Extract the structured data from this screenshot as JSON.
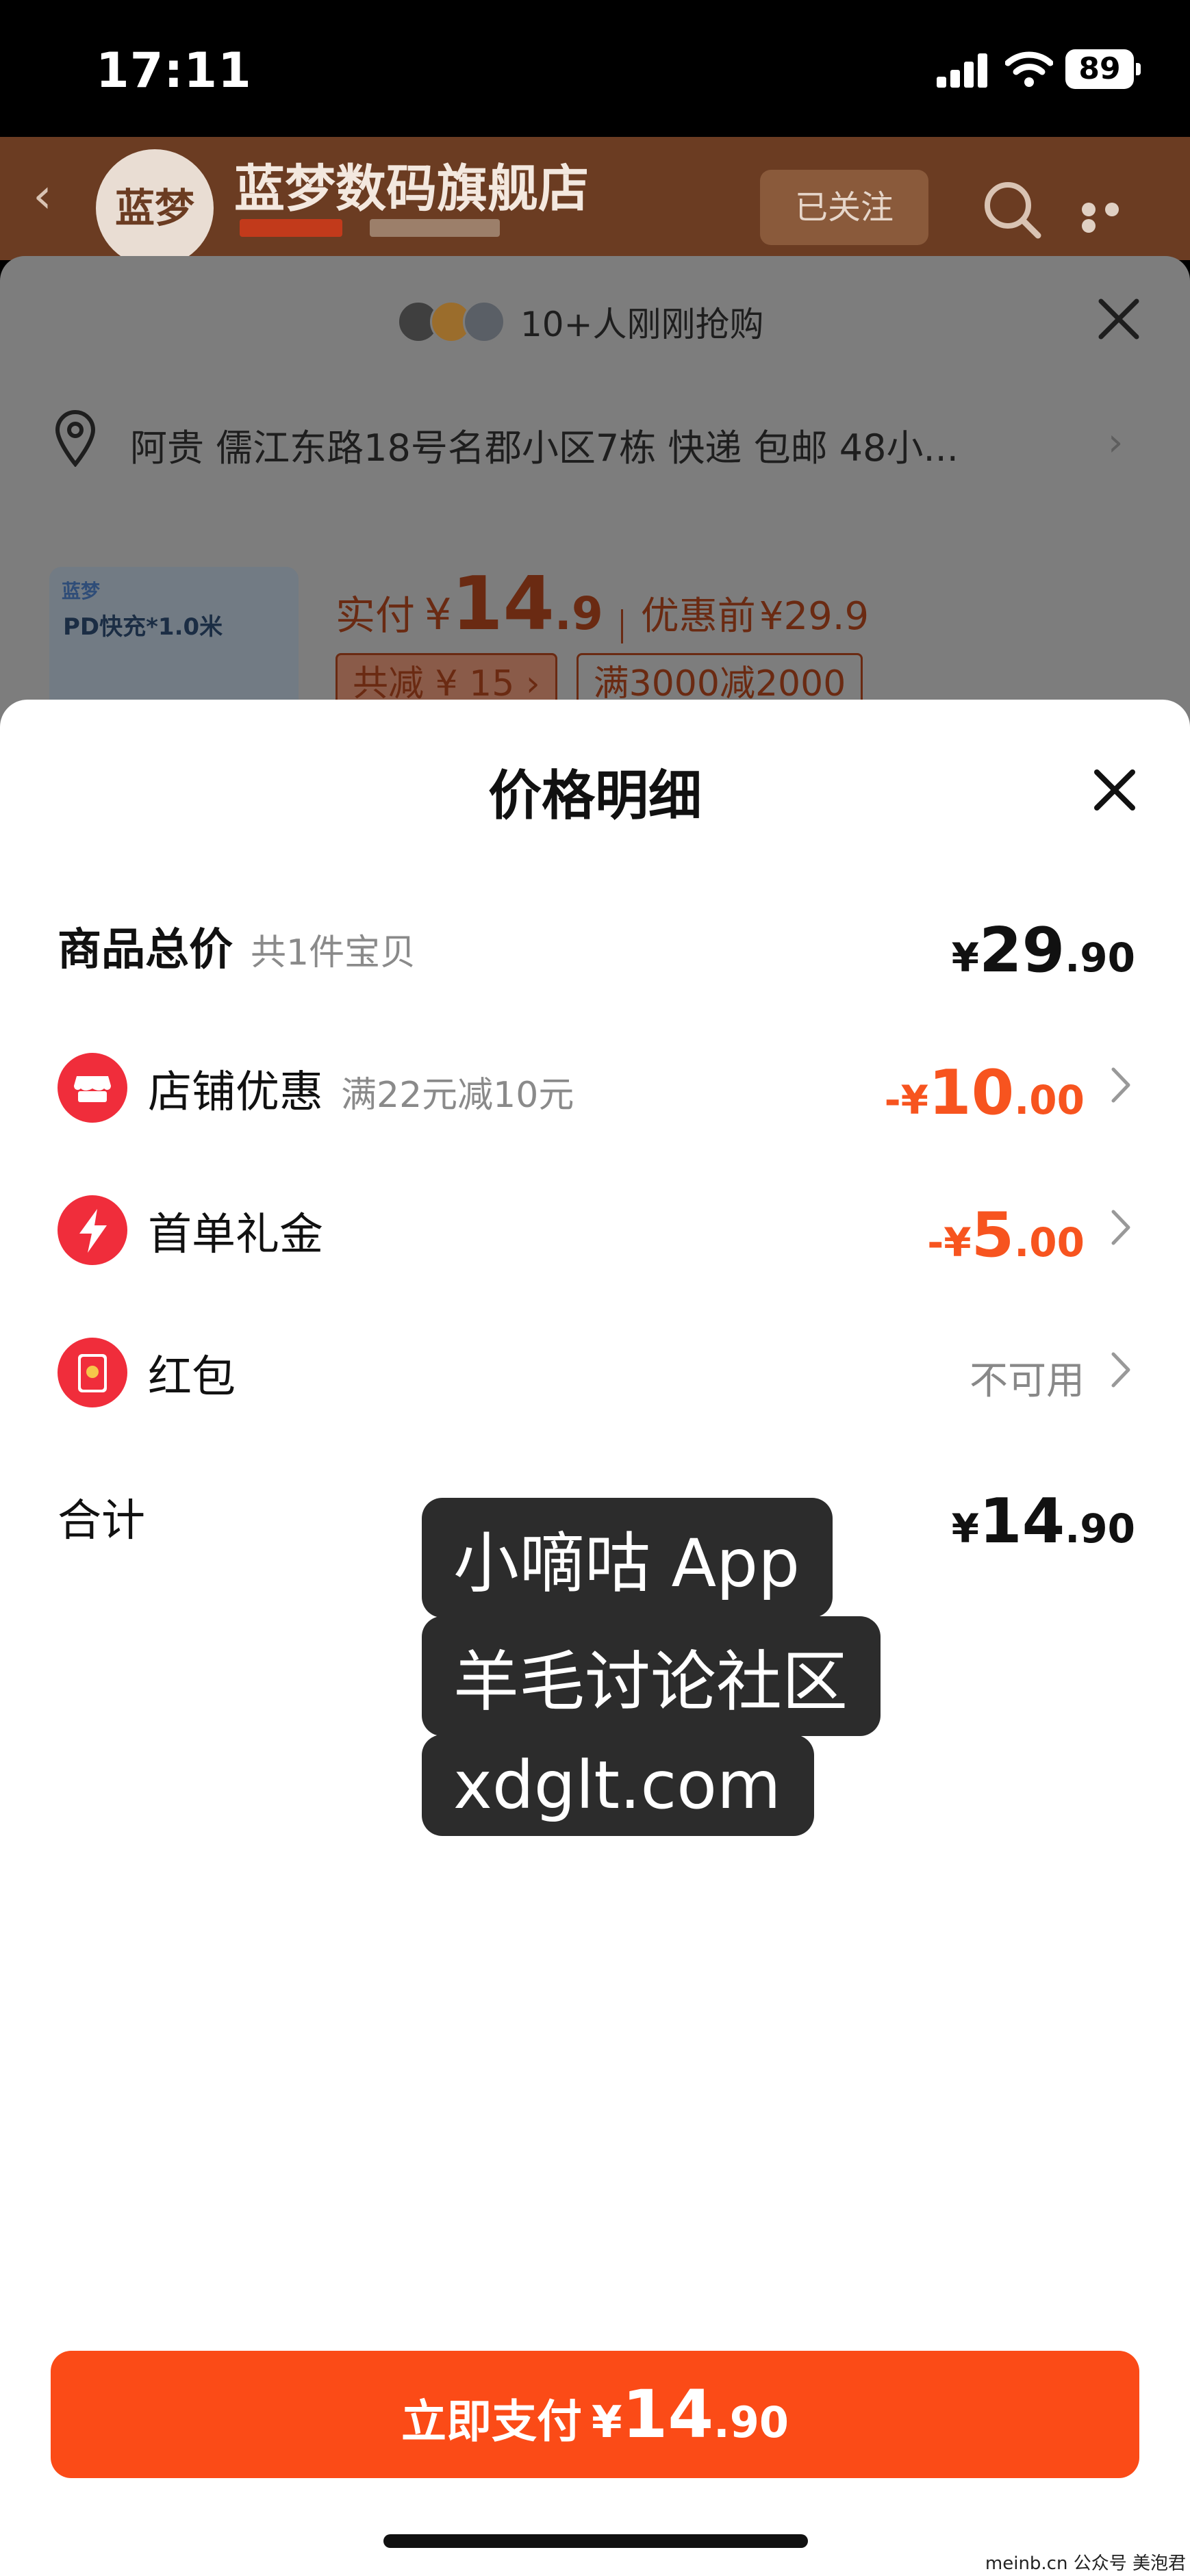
{
  "status_bar": {
    "time": "17:11",
    "battery": "89"
  },
  "store": {
    "avatar_text": "蓝梦",
    "name": "蓝梦数码旗舰店",
    "follow_label": "已关注"
  },
  "buy_sheet": {
    "buyers_text": "10+人刚刚抢购",
    "address": "阿贵 儒江东路18号名郡小区7栋 快递 包邮 48小...",
    "product_thumb_brand": "蓝梦",
    "product_thumb_text": "PD快充*1.0米",
    "price_label": "实付",
    "price_yen": "¥",
    "price_int": "14",
    "price_dec": ".9",
    "before_label": "优惠前",
    "before_price": "¥29.9",
    "tag_saving": "共减 ¥ 15 ›",
    "tag_promo": "满3000减2000"
  },
  "detail": {
    "title": "价格明细",
    "rows": [
      {
        "title": "商品总价",
        "sub": "共1件宝贝",
        "yen": "¥",
        "int": "29",
        "dec": ".90"
      },
      {
        "title": "店铺优惠",
        "sub": "满22元减10元",
        "yen": "-¥",
        "int": "10",
        "dec": ".00",
        "icon": "store-icon"
      },
      {
        "title": "首单礼金",
        "yen": "-¥",
        "int": "5",
        "dec": ".00",
        "icon": "lightning-icon"
      },
      {
        "title": "红包",
        "value": "不可用",
        "icon": "red-envelope-icon"
      },
      {
        "title": "合计",
        "yen": "¥",
        "int": "14",
        "dec": ".90"
      }
    ]
  },
  "watermark": {
    "line1": "小嘀咕 App",
    "line2": "羊毛讨论社区",
    "line3": "xdglt.com"
  },
  "pay_button": {
    "label": "立即支付",
    "yen": "¥",
    "int": "14",
    "dec": ".90"
  },
  "footer_credit": "meinb.cn 公众号 美泡君",
  "colors": {
    "accent": "#fb4b17",
    "discount": "#f7541f",
    "icon_red": "#f02d3b"
  }
}
